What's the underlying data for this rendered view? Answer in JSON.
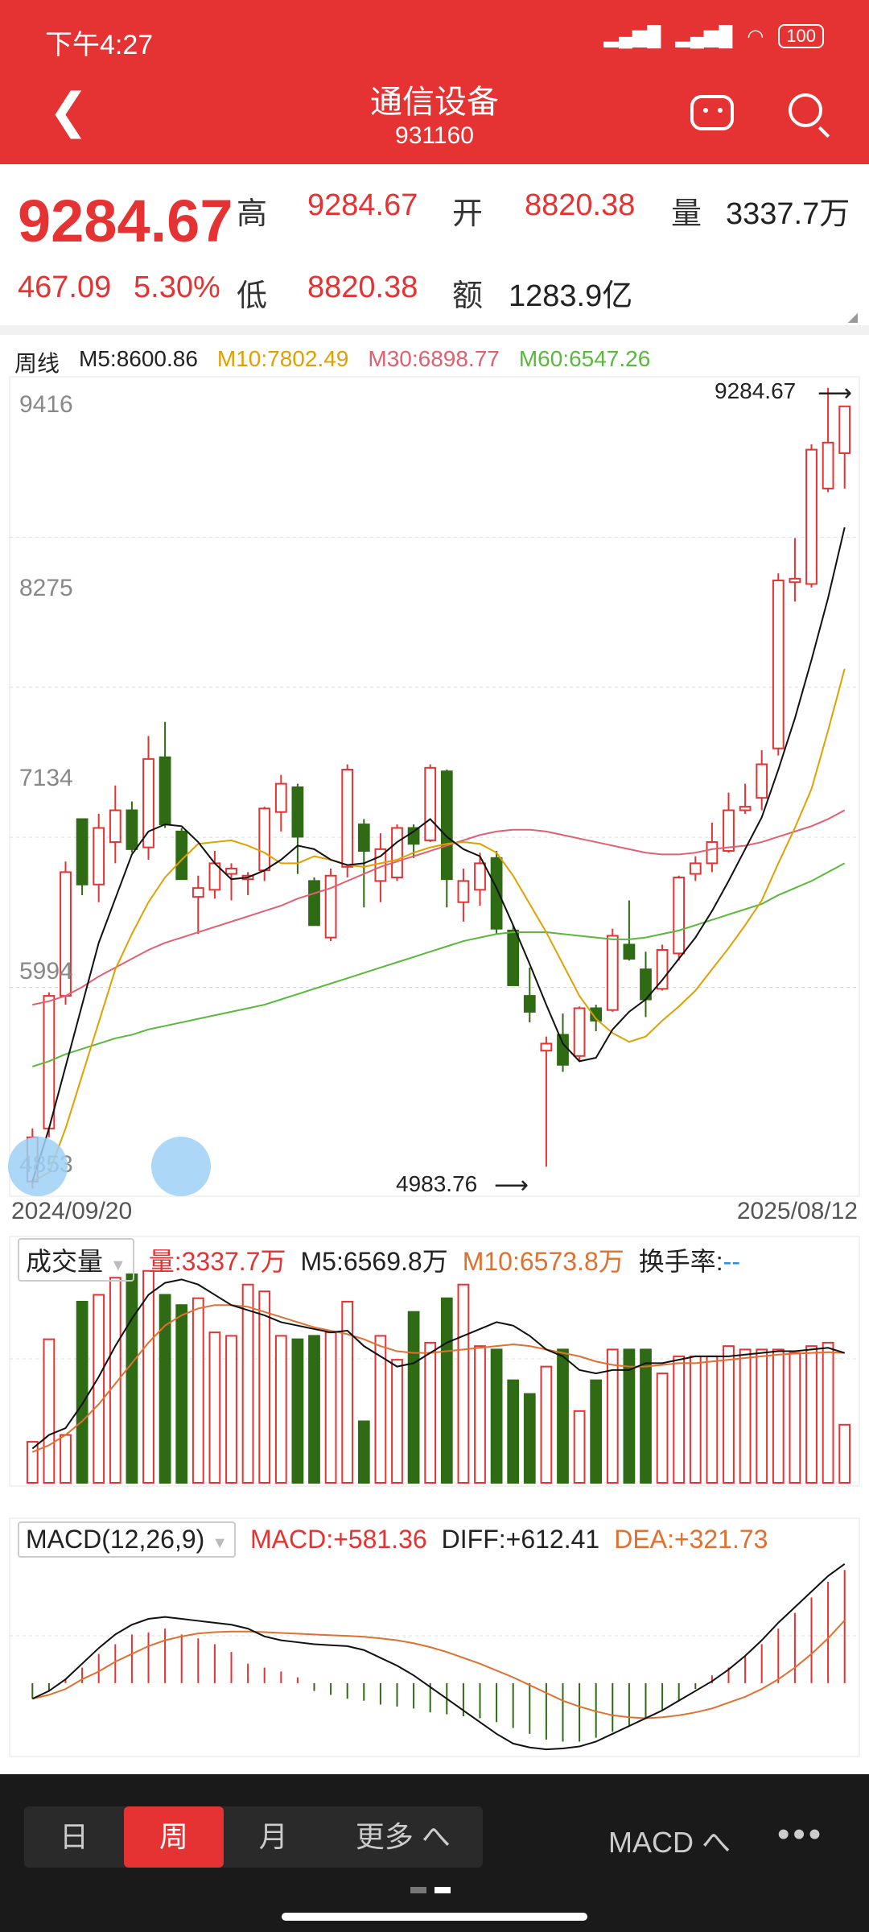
{
  "status_bar": {
    "time": "下午4:27",
    "battery": "100"
  },
  "header": {
    "title": "通信设备",
    "code": "931160"
  },
  "quote": {
    "price": "9284.67",
    "change": "467.09",
    "change_pct": "5.30%",
    "high_label": "高",
    "high": "9284.67",
    "open_label": "开",
    "open": "8820.38",
    "volume_label": "量",
    "volume": "3337.7万",
    "low_label": "低",
    "low": "8820.38",
    "amount_label": "额",
    "amount": "1283.9亿"
  },
  "ma_legend": {
    "period": "周线",
    "m5": "M5:8600.86",
    "m10": "M10:7802.49",
    "m30": "M30:6898.77",
    "m60": "M60:6547.26"
  },
  "colors": {
    "red": "#e53232",
    "green": "#2f6b14",
    "m10": "#e0a000",
    "m30": "#e06070",
    "m60": "#5ab83c"
  },
  "price_axis": {
    "ticks": [
      "9416",
      "8275",
      "7134",
      "5994",
      "4853"
    ]
  },
  "annotations": {
    "high_marker": "9284.67",
    "low_marker": "4983.76"
  },
  "dates": {
    "start": "2024/09/20",
    "end": "2025/08/12"
  },
  "volume_panel": {
    "selector": "成交量",
    "vol": "量:3337.7万",
    "m5": "M5:6569.8万",
    "m10": "M10:6573.8万",
    "turnover": "换手率:",
    "turnover_value": "--"
  },
  "macd_panel": {
    "selector": "MACD(12,26,9)",
    "macd": "MACD:+581.36",
    "diff": "DIFF:+612.41",
    "dea": "DEA:+321.73"
  },
  "bottom": {
    "tabs": [
      "日",
      "周",
      "月",
      "更多 へ"
    ],
    "active_tab": "周",
    "indicator": "MACD へ",
    "more": "•••"
  },
  "chart_data": {
    "type": "candlestick",
    "title": "",
    "period": "weekly",
    "x_range": [
      "2024/09/20",
      "2025/08/12"
    ],
    "ylim": [
      4853,
      9416
    ],
    "candles": [
      {
        "o": 4900,
        "h": 5200,
        "l": 4860,
        "c": 5150
      },
      {
        "o": 5200,
        "h": 5970,
        "l": 5150,
        "c": 5950
      },
      {
        "o": 5950,
        "h": 6710,
        "l": 5900,
        "c": 6650
      },
      {
        "o": 6950,
        "h": 6950,
        "l": 6520,
        "c": 6580
      },
      {
        "o": 6580,
        "h": 6980,
        "l": 6480,
        "c": 6900
      },
      {
        "o": 6820,
        "h": 7140,
        "l": 6700,
        "c": 7000
      },
      {
        "o": 7000,
        "h": 7050,
        "l": 6760,
        "c": 6780
      },
      {
        "o": 6790,
        "h": 7420,
        "l": 6720,
        "c": 7290
      },
      {
        "o": 7300,
        "h": 7500,
        "l": 6900,
        "c": 6920
      },
      {
        "o": 6880,
        "h": 6900,
        "l": 6610,
        "c": 6610
      },
      {
        "o": 6510,
        "h": 6630,
        "l": 6300,
        "c": 6560
      },
      {
        "o": 6550,
        "h": 6770,
        "l": 6500,
        "c": 6700
      },
      {
        "o": 6640,
        "h": 6700,
        "l": 6490,
        "c": 6670
      },
      {
        "o": 6610,
        "h": 6650,
        "l": 6520,
        "c": 6630
      },
      {
        "o": 6660,
        "h": 7020,
        "l": 6600,
        "c": 7010
      },
      {
        "o": 6990,
        "h": 7200,
        "l": 6880,
        "c": 7150
      },
      {
        "o": 7130,
        "h": 7150,
        "l": 6640,
        "c": 6850
      },
      {
        "o": 6600,
        "h": 6620,
        "l": 6350,
        "c": 6350
      },
      {
        "o": 6280,
        "h": 6670,
        "l": 6260,
        "c": 6630
      },
      {
        "o": 6680,
        "h": 7260,
        "l": 6620,
        "c": 7230
      },
      {
        "o": 6920,
        "h": 6950,
        "l": 6450,
        "c": 6770
      },
      {
        "o": 6600,
        "h": 6870,
        "l": 6480,
        "c": 6780
      },
      {
        "o": 6620,
        "h": 6920,
        "l": 6600,
        "c": 6900
      },
      {
        "o": 6900,
        "h": 6920,
        "l": 6730,
        "c": 6810
      },
      {
        "o": 6830,
        "h": 7260,
        "l": 6820,
        "c": 7240
      },
      {
        "o": 7220,
        "h": 7230,
        "l": 6450,
        "c": 6610
      },
      {
        "o": 6480,
        "h": 6670,
        "l": 6370,
        "c": 6600
      },
      {
        "o": 6550,
        "h": 6760,
        "l": 6460,
        "c": 6700
      },
      {
        "o": 6730,
        "h": 6770,
        "l": 6300,
        "c": 6330
      },
      {
        "o": 6320,
        "h": 6350,
        "l": 6010,
        "c": 6010
      },
      {
        "o": 5950,
        "h": 6110,
        "l": 5800,
        "c": 5860
      },
      {
        "o": 5640,
        "h": 5720,
        "l": 4984,
        "c": 5680
      },
      {
        "o": 5730,
        "h": 5850,
        "l": 5520,
        "c": 5560
      },
      {
        "o": 5610,
        "h": 5890,
        "l": 5580,
        "c": 5880
      },
      {
        "o": 5880,
        "h": 5900,
        "l": 5750,
        "c": 5810
      },
      {
        "o": 5870,
        "h": 6330,
        "l": 5860,
        "c": 6290
      },
      {
        "o": 6240,
        "h": 6490,
        "l": 6150,
        "c": 6160
      },
      {
        "o": 6100,
        "h": 6200,
        "l": 5830,
        "c": 5930
      },
      {
        "o": 5990,
        "h": 6240,
        "l": 5980,
        "c": 6210
      },
      {
        "o": 6190,
        "h": 6630,
        "l": 6150,
        "c": 6620
      },
      {
        "o": 6640,
        "h": 6740,
        "l": 6600,
        "c": 6700
      },
      {
        "o": 6700,
        "h": 6930,
        "l": 6650,
        "c": 6820
      },
      {
        "o": 6770,
        "h": 7100,
        "l": 6760,
        "c": 7000
      },
      {
        "o": 7000,
        "h": 7150,
        "l": 6980,
        "c": 7020
      },
      {
        "o": 7070,
        "h": 7340,
        "l": 7000,
        "c": 7260
      },
      {
        "o": 7350,
        "h": 8340,
        "l": 7310,
        "c": 8300
      },
      {
        "o": 8290,
        "h": 8540,
        "l": 8180,
        "c": 8310
      },
      {
        "o": 8280,
        "h": 9070,
        "l": 8260,
        "c": 9040
      },
      {
        "o": 8820,
        "h": 9390,
        "l": 8800,
        "c": 9080
      },
      {
        "o": 9020,
        "h": 9285,
        "l": 8820,
        "c": 9285
      }
    ],
    "ma5": [
      4900,
      5200,
      5550,
      5900,
      6250,
      6500,
      6750,
      6880,
      6920,
      6910,
      6820,
      6700,
      6610,
      6620,
      6660,
      6720,
      6800,
      6780,
      6720,
      6690,
      6700,
      6740,
      6820,
      6880,
      6950,
      6850,
      6780,
      6740,
      6560,
      6350,
      6130,
      5900,
      5680,
      5580,
      5600,
      5760,
      5860,
      5930,
      6040,
      6160,
      6280,
      6430,
      6600,
      6780,
      6960,
      7230,
      7520,
      7850,
      8200,
      8600
    ],
    "ma10": [
      4900,
      4950,
      5200,
      5500,
      5800,
      6100,
      6300,
      6480,
      6620,
      6720,
      6810,
      6820,
      6830,
      6800,
      6760,
      6700,
      6700,
      6740,
      6720,
      6690,
      6680,
      6700,
      6720,
      6760,
      6790,
      6810,
      6820,
      6810,
      6760,
      6630,
      6470,
      6310,
      6130,
      5950,
      5820,
      5740,
      5690,
      5720,
      5810,
      5890,
      5980,
      6100,
      6220,
      6350,
      6490,
      6700,
      6900,
      7120,
      7450,
      7800
    ],
    "ma30": [
      5900,
      5920,
      5950,
      6000,
      6060,
      6110,
      6160,
      6210,
      6250,
      6280,
      6310,
      6340,
      6370,
      6400,
      6430,
      6460,
      6500,
      6530,
      6560,
      6600,
      6640,
      6680,
      6710,
      6740,
      6770,
      6800,
      6830,
      6860,
      6880,
      6890,
      6890,
      6880,
      6860,
      6840,
      6820,
      6800,
      6780,
      6760,
      6750,
      6750,
      6760,
      6780,
      6790,
      6800,
      6820,
      6850,
      6880,
      6910,
      6950,
      7000
    ],
    "ma60": [
      5550,
      5580,
      5620,
      5650,
      5680,
      5710,
      5730,
      5760,
      5780,
      5800,
      5820,
      5840,
      5860,
      5880,
      5900,
      5930,
      5960,
      5990,
      6020,
      6050,
      6080,
      6110,
      6140,
      6170,
      6200,
      6230,
      6260,
      6280,
      6300,
      6310,
      6310,
      6310,
      6300,
      6290,
      6280,
      6270,
      6270,
      6280,
      6300,
      6320,
      6350,
      6380,
      6410,
      6440,
      6470,
      6520,
      6560,
      6600,
      6650,
      6700
    ],
    "volume": {
      "values": [
        1200,
        4200,
        1400,
        5300,
        5500,
        6000,
        6100,
        6200,
        5500,
        5200,
        5400,
        4400,
        4300,
        5800,
        5600,
        4300,
        4200,
        4300,
        4400,
        5300,
        1800,
        4300,
        3600,
        5000,
        4100,
        5400,
        5800,
        4000,
        3900,
        3000,
        2600,
        3400,
        3900,
        2100,
        3000,
        3900,
        3900,
        3900,
        3200,
        3700,
        3700,
        3700,
        4000,
        3900,
        3900,
        3900,
        3800,
        4000,
        4100,
        1700
      ],
      "ylim": [
        0,
        6500
      ],
      "m5": [
        1000,
        1400,
        1600,
        2300,
        3100,
        4000,
        4800,
        5500,
        5850,
        5950,
        5800,
        5500,
        5200,
        5050,
        4900,
        4700,
        4600,
        4500,
        4400,
        4450,
        4000,
        3700,
        3400,
        3500,
        3800,
        4100,
        4300,
        4500,
        4700,
        4600,
        4300,
        3900,
        3700,
        3300,
        3200,
        3300,
        3300,
        3500,
        3500,
        3600,
        3700,
        3700,
        3700,
        3750,
        3800,
        3850,
        3850,
        3900,
        3950,
        3800
      ],
      "m10": [
        900,
        1100,
        1400,
        1800,
        2300,
        2900,
        3500,
        4100,
        4600,
        4900,
        5100,
        5200,
        5200,
        5150,
        5000,
        4850,
        4700,
        4550,
        4450,
        4350,
        4200,
        4000,
        3850,
        3800,
        3800,
        3850,
        3900,
        3950,
        4000,
        4050,
        4000,
        3900,
        3800,
        3700,
        3550,
        3450,
        3400,
        3400,
        3450,
        3500,
        3500,
        3550,
        3600,
        3650,
        3700,
        3750,
        3780,
        3800,
        3820,
        3800
      ]
    },
    "macd": {
      "hist": [
        -80,
        -40,
        20,
        80,
        150,
        200,
        250,
        260,
        280,
        250,
        230,
        200,
        160,
        100,
        80,
        60,
        30,
        -40,
        -60,
        -80,
        -90,
        -110,
        -120,
        -130,
        -150,
        -160,
        -170,
        -180,
        -200,
        -230,
        -260,
        -290,
        -300,
        -300,
        -280,
        -250,
        -220,
        -180,
        -140,
        -90,
        -30,
        40,
        80,
        140,
        200,
        280,
        360,
        440,
        520,
        581
      ],
      "diff": [
        -80,
        -40,
        20,
        100,
        180,
        250,
        300,
        330,
        340,
        330,
        320,
        310,
        300,
        280,
        240,
        220,
        210,
        200,
        195,
        190,
        170,
        130,
        90,
        40,
        -20,
        -80,
        -140,
        -200,
        -260,
        -310,
        -330,
        -340,
        -335,
        -325,
        -300,
        -260,
        -220,
        -180,
        -140,
        -90,
        -40,
        10,
        70,
        140,
        220,
        310,
        390,
        470,
        550,
        612
      ],
      "dea": [
        -80,
        -60,
        -30,
        20,
        60,
        110,
        150,
        190,
        220,
        240,
        255,
        262,
        265,
        265,
        262,
        258,
        254,
        250,
        246,
        243,
        238,
        230,
        220,
        205,
        185,
        160,
        130,
        100,
        65,
        30,
        -10,
        -50,
        -90,
        -120,
        -145,
        -165,
        -175,
        -180,
        -175,
        -165,
        -150,
        -130,
        -100,
        -70,
        -30,
        20,
        80,
        150,
        230,
        322
      ],
      "ylim": [
        -360,
        640
      ]
    }
  }
}
